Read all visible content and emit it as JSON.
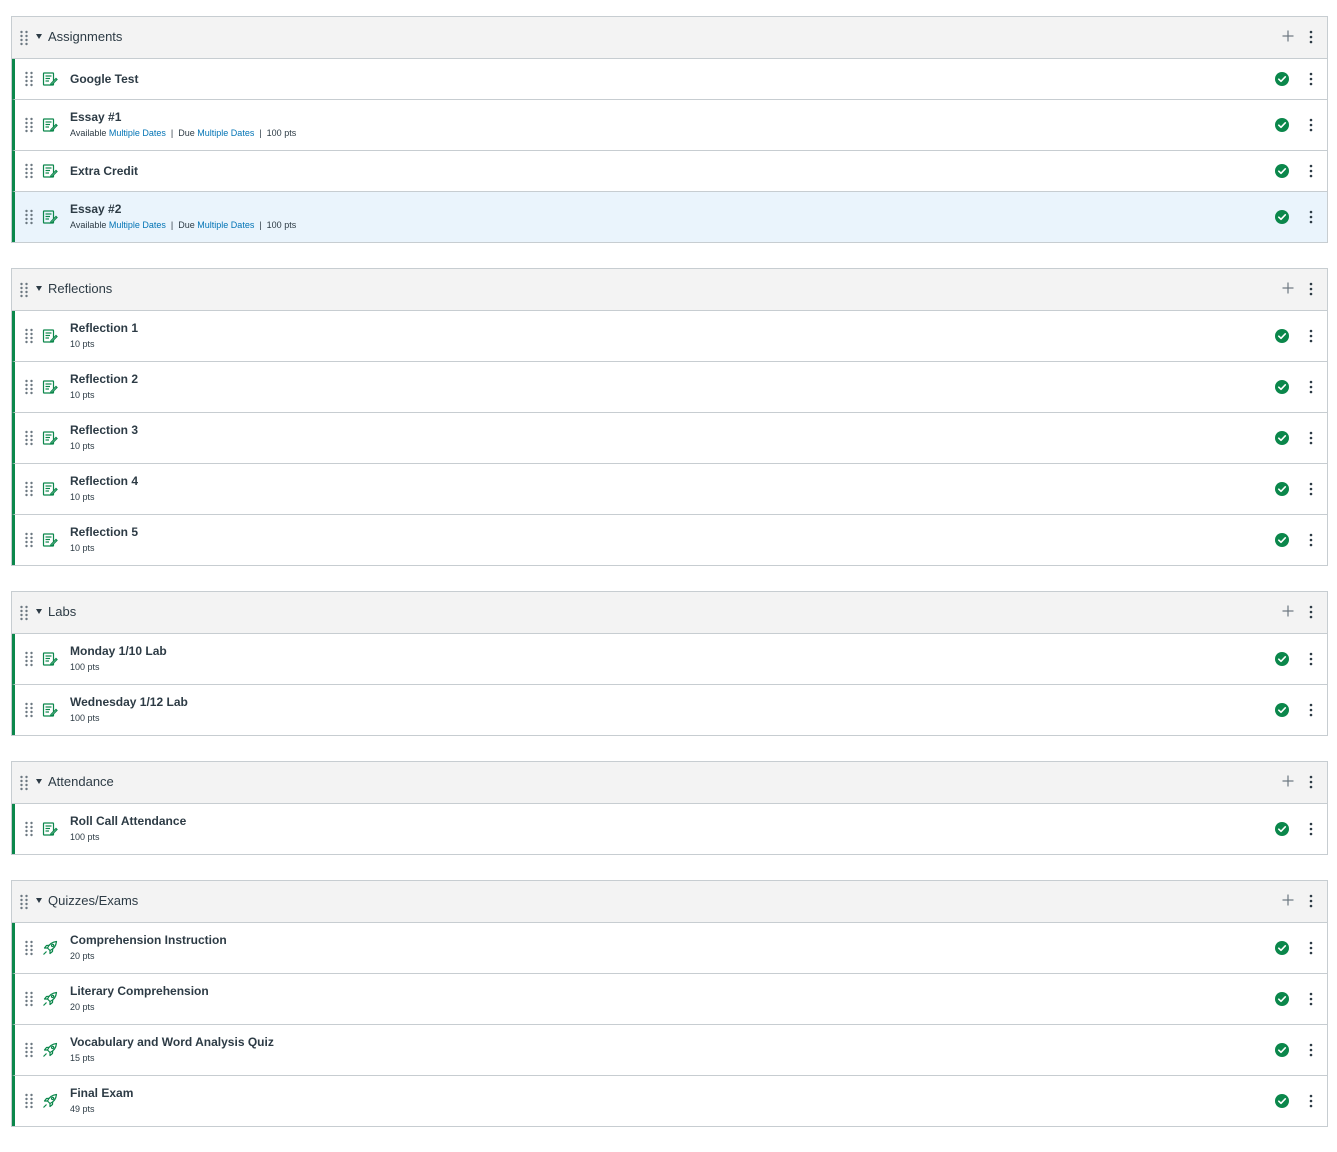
{
  "colors": {
    "accent_green": "#0b874b",
    "link_blue": "#0374b5",
    "text": "#2d3b45",
    "highlight": "#eaf4fc"
  },
  "icons": {
    "drag": "drag-handle-icon",
    "assignment": "assignment-icon",
    "quiz": "quiz-rocket-icon",
    "published": "published-check-icon",
    "more": "kebab-icon",
    "add": "plus-icon",
    "collapse": "caret-down-icon"
  },
  "groups": [
    {
      "title": "Assignments",
      "items": [
        {
          "title": "Google Test",
          "type": "assignment"
        },
        {
          "title": "Essay #1",
          "type": "assignment",
          "available_label": "Available",
          "available_value": "Multiple Dates",
          "due_label": "Due",
          "due_value": "Multiple Dates",
          "points": "100 pts"
        },
        {
          "title": "Extra Credit",
          "type": "assignment"
        },
        {
          "title": "Essay #2",
          "type": "assignment",
          "available_label": "Available",
          "available_value": "Multiple Dates",
          "due_label": "Due",
          "due_value": "Multiple Dates",
          "points": "100 pts",
          "highlighted": true
        }
      ]
    },
    {
      "title": "Reflections",
      "items": [
        {
          "title": "Reflection 1",
          "type": "assignment",
          "points": "10 pts"
        },
        {
          "title": "Reflection 2",
          "type": "assignment",
          "points": "10 pts"
        },
        {
          "title": "Reflection 3",
          "type": "assignment",
          "points": "10 pts"
        },
        {
          "title": "Reflection 4",
          "type": "assignment",
          "points": "10 pts"
        },
        {
          "title": "Reflection 5",
          "type": "assignment",
          "points": "10 pts"
        }
      ]
    },
    {
      "title": "Labs",
      "items": [
        {
          "title": "Monday 1/10 Lab",
          "type": "assignment",
          "points": "100 pts"
        },
        {
          "title": "Wednesday 1/12 Lab",
          "type": "assignment",
          "points": "100 pts"
        }
      ]
    },
    {
      "title": "Attendance",
      "items": [
        {
          "title": "Roll Call Attendance",
          "type": "assignment",
          "points": "100 pts"
        }
      ]
    },
    {
      "title": "Quizzes/Exams",
      "items": [
        {
          "title": "Comprehension Instruction",
          "type": "quiz",
          "points": "20 pts"
        },
        {
          "title": "Literary Comprehension",
          "type": "quiz",
          "points": "20 pts"
        },
        {
          "title": "Vocabulary and Word Analysis Quiz",
          "type": "quiz",
          "points": "15 pts"
        },
        {
          "title": "Final Exam",
          "type": "quiz",
          "points": "49 pts"
        }
      ]
    }
  ]
}
